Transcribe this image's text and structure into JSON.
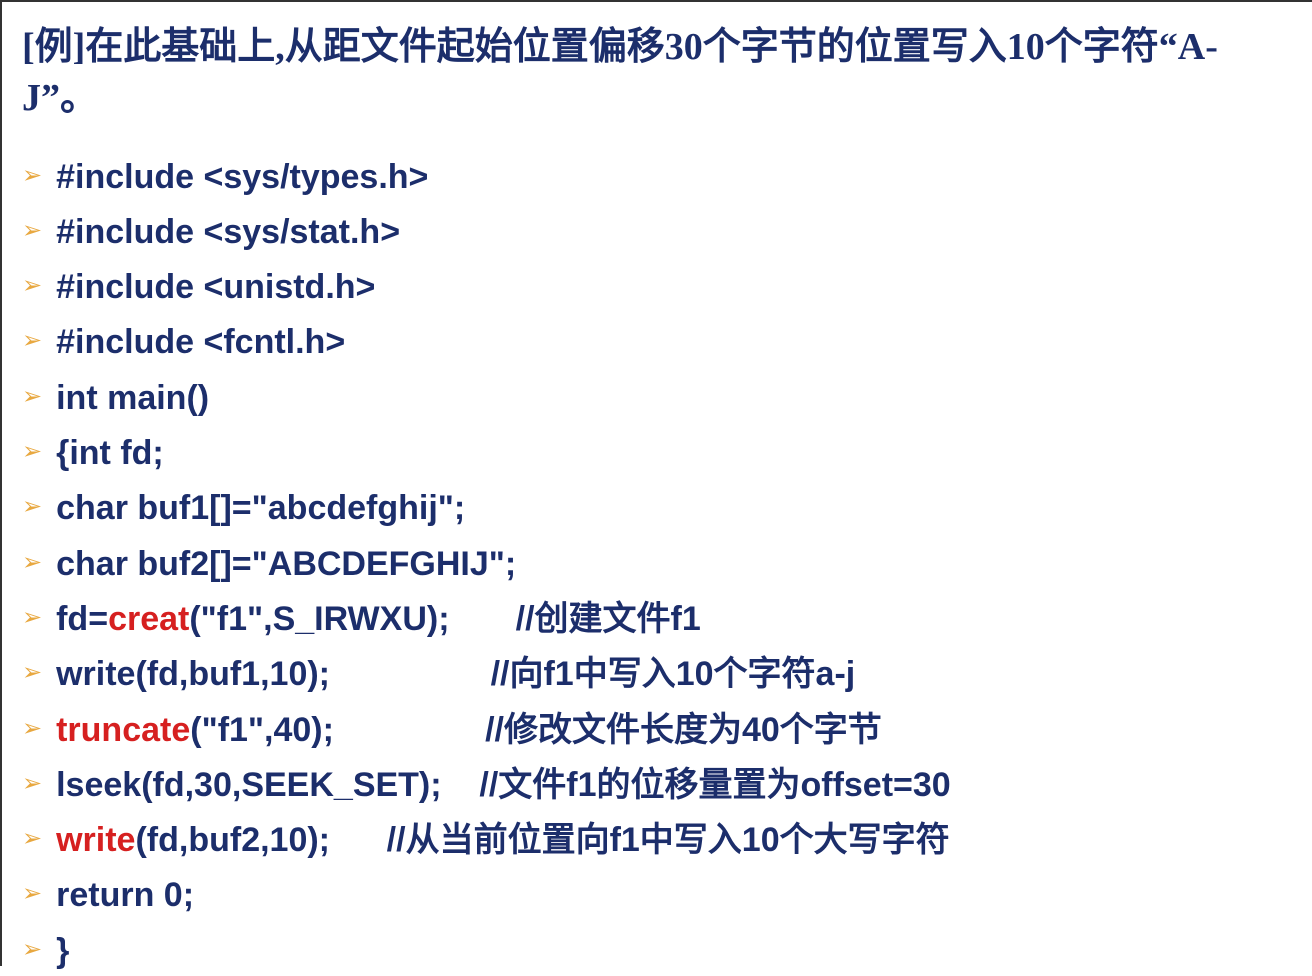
{
  "title": "[例]在此基础上,从距文件起始位置偏移30个字节的位置写入10个字符“A-J”。",
  "lines": [
    {
      "pre": "#include <sys/types.h>",
      "hl": "",
      "post": ""
    },
    {
      "pre": "#include <sys/stat.h>",
      "hl": "",
      "post": ""
    },
    {
      "pre": "#include <unistd.h>",
      "hl": "",
      "post": ""
    },
    {
      "pre": "#include <fcntl.h>",
      "hl": "",
      "post": ""
    },
    {
      "pre": "int main()",
      "hl": "",
      "post": ""
    },
    {
      "pre": "{int fd;",
      "hl": "",
      "post": ""
    },
    {
      "pre": "char buf1[]=\"abcdefghij\";",
      "hl": "",
      "post": ""
    },
    {
      "pre": "char buf2[]=\"ABCDEFGHIJ\";",
      "hl": "",
      "post": ""
    },
    {
      "pre": "fd=",
      "hl": "creat",
      "post": "(\"f1\",S_IRWXU);       //创建文件f1"
    },
    {
      "pre": "write(fd,buf1,10);                 //向f1中写入10个字符a-j",
      "hl": "",
      "post": ""
    },
    {
      "pre": "",
      "hl": "truncate",
      "post": "(\"f1\",40);                //修改文件长度为40个字节"
    },
    {
      "pre": "lseek(fd,30,SEEK_SET);    //文件f1的位移量置为offset=30",
      "hl": "",
      "post": ""
    },
    {
      "pre": "",
      "hl": "write",
      "post": "(fd,buf2,10);      //从当前位置向f1中写入10个大写字符"
    },
    {
      "pre": "return 0;",
      "hl": "",
      "post": ""
    },
    {
      "pre": "}",
      "hl": "",
      "post": ""
    }
  ],
  "bullet": "➢"
}
